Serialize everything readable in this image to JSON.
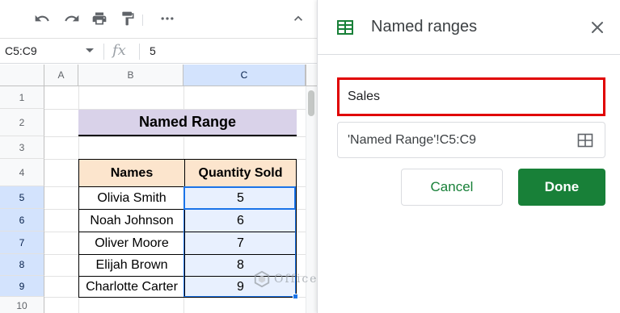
{
  "sheet": {
    "toolbar": {
      "icons": [
        "undo-icon",
        "redo-icon",
        "print-icon",
        "paint-format-icon",
        "more-icon",
        "collapse-icon"
      ]
    },
    "formula_bar": {
      "name_box": "C5:C9",
      "fx_label": "fx",
      "value": "5"
    },
    "columns": [
      "A",
      "B",
      "C"
    ],
    "rows": [
      "1",
      "2",
      "3",
      "4",
      "5",
      "6",
      "7",
      "8",
      "9",
      "10"
    ],
    "title": "Named Range",
    "table": {
      "headers": [
        "Names",
        "Quantity Sold"
      ],
      "rows": [
        {
          "name": "Olivia Smith",
          "qty": "5"
        },
        {
          "name": "Noah Johnson",
          "qty": "6"
        },
        {
          "name": "Oliver Moore",
          "qty": "7"
        },
        {
          "name": "Elijah Brown",
          "qty": "8"
        },
        {
          "name": "Charlotte Carter",
          "qty": "9"
        }
      ]
    },
    "watermark": "OfficeWheel"
  },
  "panel": {
    "title": "Named ranges",
    "name_value": "Sales",
    "range_value": "'Named Range'!C5:C9",
    "cancel_label": "Cancel",
    "done_label": "Done"
  },
  "colors": {
    "accent_green": "#188038",
    "selection_blue": "#1a73e8",
    "highlight_red": "#e00000",
    "title_fill": "#d9d2e9",
    "header_fill": "#fce5cd"
  }
}
